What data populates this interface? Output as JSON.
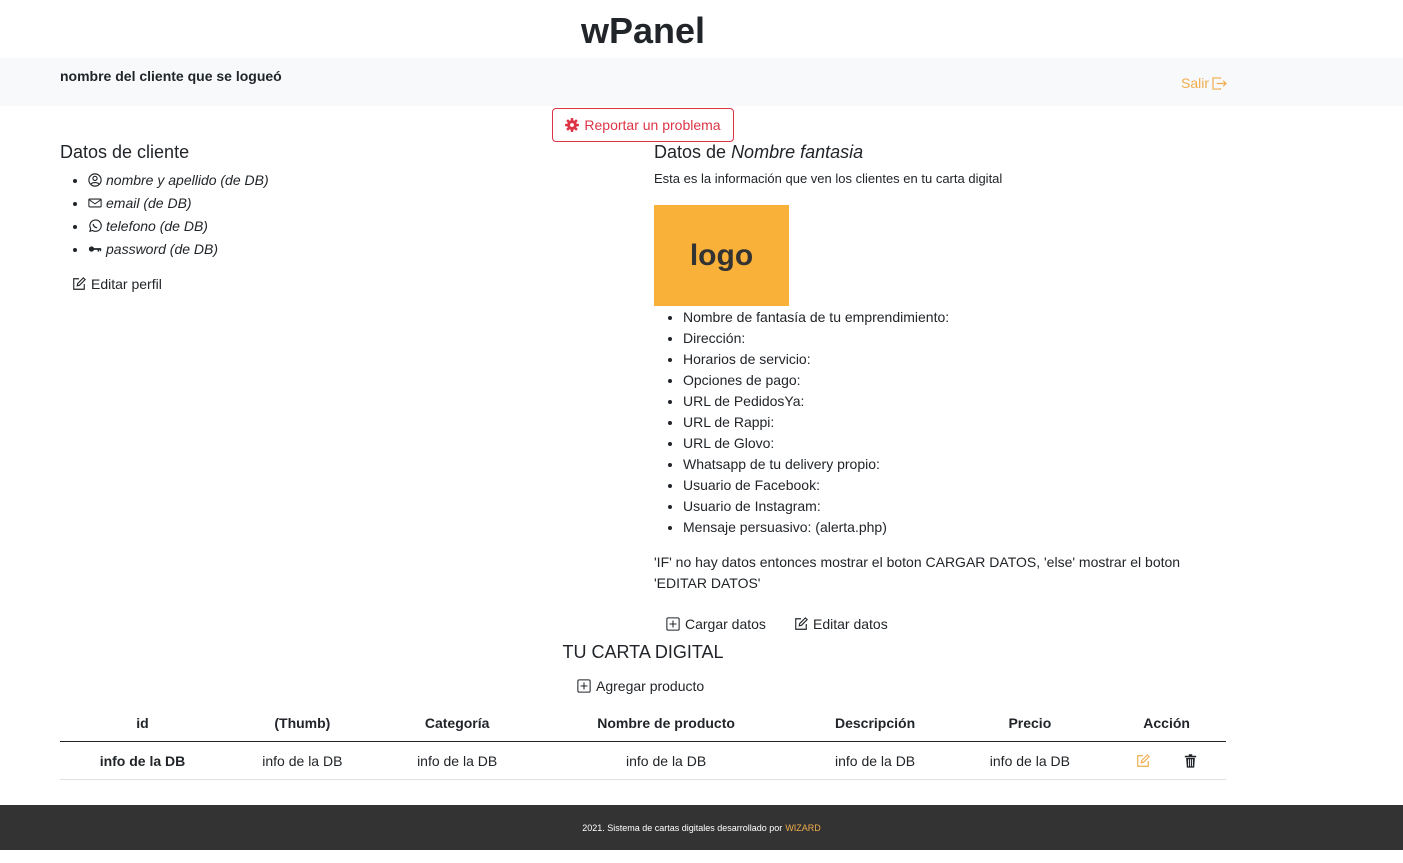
{
  "header": {
    "title": "wPanel",
    "client_name": "nombre del cliente que se logueó",
    "logout_label": "Salir"
  },
  "report_button": {
    "label": "Reportar un problema"
  },
  "client_section": {
    "title": "Datos de cliente",
    "items": [
      {
        "icon": "user-circle-icon",
        "label": "nombre y apellido (de DB)"
      },
      {
        "icon": "envelope-icon",
        "label": "email (de DB)"
      },
      {
        "icon": "whatsapp-icon",
        "label": "telefono (de DB)"
      },
      {
        "icon": "key-icon",
        "label": "password (de DB)"
      }
    ],
    "edit_label": "Editar perfil"
  },
  "business_section": {
    "title_prefix": "Datos de",
    "title_name": "Nombre fantasia",
    "description": "Esta es la información que ven los clientes en tu carta digital",
    "logo_text": "logo",
    "fields": [
      "Nombre de fantasía de tu emprendimiento:",
      "Dirección:",
      "Horarios de servicio:",
      "Opciones de pago:",
      "URL de PedidosYa:",
      "URL de Rappi:",
      "URL de Glovo:",
      "Whatsapp de tu delivery propio:",
      "Usuario de Facebook:",
      "Usuario de Instagram:",
      "Mensaje persuasivo: (alerta.php)"
    ],
    "note": "'IF' no hay datos entonces mostrar el boton CARGAR DATOS, 'else' mostrar el boton 'EDITAR DATOS'",
    "load_label": "Cargar datos",
    "edit_label": "Editar datos"
  },
  "menu_section": {
    "title": "TU CARTA DIGITAL",
    "add_label": "Agregar producto",
    "columns": [
      "id",
      "(Thumb)",
      "Categoría",
      "Nombre de producto",
      "Descripción",
      "Precio",
      "Acción"
    ],
    "rows": [
      [
        "info de la DB",
        "info de la DB",
        "info de la DB",
        "info de la DB",
        "info de la DB",
        "info de la DB"
      ]
    ]
  },
  "footer": {
    "text": "2021. Sistema de cartas digitales desarrollado por",
    "brand": "WIZARD"
  },
  "colors": {
    "accent": "#f0ad4e",
    "danger": "#dc3545",
    "logo_bg": "#f9b13a",
    "footer_bg": "#333333",
    "topbar_bg": "#f8f9fa"
  }
}
